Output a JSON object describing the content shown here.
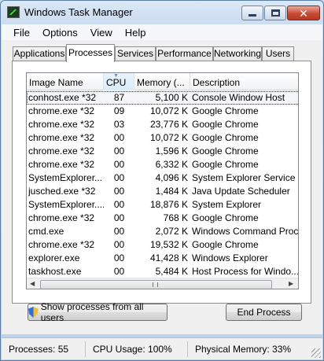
{
  "window": {
    "title": "Windows Task Manager"
  },
  "menu": [
    {
      "label": "File"
    },
    {
      "label": "Options"
    },
    {
      "label": "View"
    },
    {
      "label": "Help"
    }
  ],
  "tabs": [
    {
      "label": "Applications",
      "active": false
    },
    {
      "label": "Processes",
      "active": true
    },
    {
      "label": "Services",
      "active": false
    },
    {
      "label": "Performance",
      "active": false
    },
    {
      "label": "Networking",
      "active": false
    },
    {
      "label": "Users",
      "active": false
    }
  ],
  "table": {
    "columns": [
      {
        "label": "Image Name"
      },
      {
        "label": "CPU",
        "sorted": true
      },
      {
        "label": "Memory (..."
      },
      {
        "label": "Description"
      }
    ],
    "rows": [
      {
        "name": "conhost.exe *32",
        "cpu": "87",
        "memory": "5,100 K",
        "description": "Console Window Host",
        "selected": true
      },
      {
        "name": "chrome.exe *32",
        "cpu": "09",
        "memory": "10,072 K",
        "description": "Google Chrome"
      },
      {
        "name": "chrome.exe *32",
        "cpu": "03",
        "memory": "23,776 K",
        "description": "Google Chrome"
      },
      {
        "name": "chrome.exe *32",
        "cpu": "00",
        "memory": "10,072 K",
        "description": "Google Chrome"
      },
      {
        "name": "chrome.exe *32",
        "cpu": "00",
        "memory": "1,596 K",
        "description": "Google Chrome"
      },
      {
        "name": "chrome.exe *32",
        "cpu": "00",
        "memory": "6,332 K",
        "description": "Google Chrome"
      },
      {
        "name": "SystemExplorer...",
        "cpu": "00",
        "memory": "4,096 K",
        "description": "System Explorer Service"
      },
      {
        "name": "jusched.exe *32",
        "cpu": "00",
        "memory": "1,484 K",
        "description": "Java Update Scheduler"
      },
      {
        "name": "SystemExplorer....",
        "cpu": "00",
        "memory": "18,876 K",
        "description": "System Explorer"
      },
      {
        "name": "chrome.exe *32",
        "cpu": "00",
        "memory": "768 K",
        "description": "Google Chrome"
      },
      {
        "name": "cmd.exe",
        "cpu": "00",
        "memory": "2,072 K",
        "description": "Windows Command Proc"
      },
      {
        "name": "chrome.exe *32",
        "cpu": "00",
        "memory": "19,532 K",
        "description": "Google Chrome"
      },
      {
        "name": "explorer.exe",
        "cpu": "00",
        "memory": "41,428 K",
        "description": "Windows Explorer"
      },
      {
        "name": "taskhost.exe",
        "cpu": "00",
        "memory": "5,484 K",
        "description": "Host Process for Windo..."
      }
    ]
  },
  "buttons": {
    "show_all": "Show processes from all users",
    "end_process": "End Process"
  },
  "status": {
    "processes": "Processes: 55",
    "cpu": "CPU Usage: 100%",
    "memory": "Physical Memory: 33%"
  },
  "icons": {
    "app": "task-manager-icon",
    "shield": "uac-shield-icon"
  }
}
